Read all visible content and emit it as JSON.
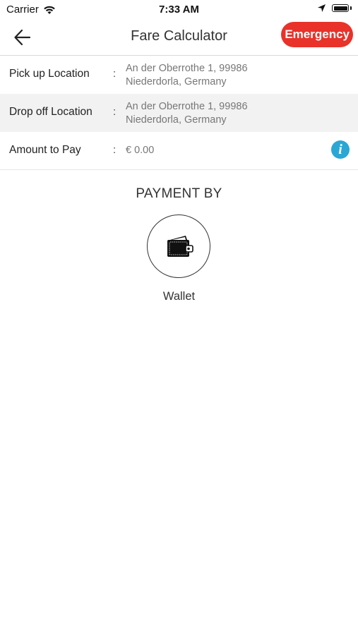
{
  "status_bar": {
    "carrier": "Carrier",
    "time": "7:33 AM"
  },
  "header": {
    "title": "Fare Calculator",
    "emergency_label": "Emergency"
  },
  "details": {
    "pickup": {
      "label": "Pick up Location",
      "separator": ":",
      "value_line1": "An der Oberrothe 1, 99986",
      "value_line2": "Niederdorla, Germany"
    },
    "dropoff": {
      "label": "Drop off Location",
      "separator": ":",
      "value_line1": "An der Oberrothe 1, 99986",
      "value_line2": "Niederdorla, Germany"
    },
    "amount": {
      "label": "Amount to Pay",
      "separator": ":",
      "value": "€ 0.00",
      "info_glyph": "i"
    }
  },
  "payment": {
    "heading": "PAYMENT BY",
    "method_label": "Wallet",
    "method_icon": "wallet-icon"
  },
  "colors": {
    "emergency": "#e8322a",
    "info": "#2aa7d4",
    "alt_row": "#f2f2f2"
  }
}
